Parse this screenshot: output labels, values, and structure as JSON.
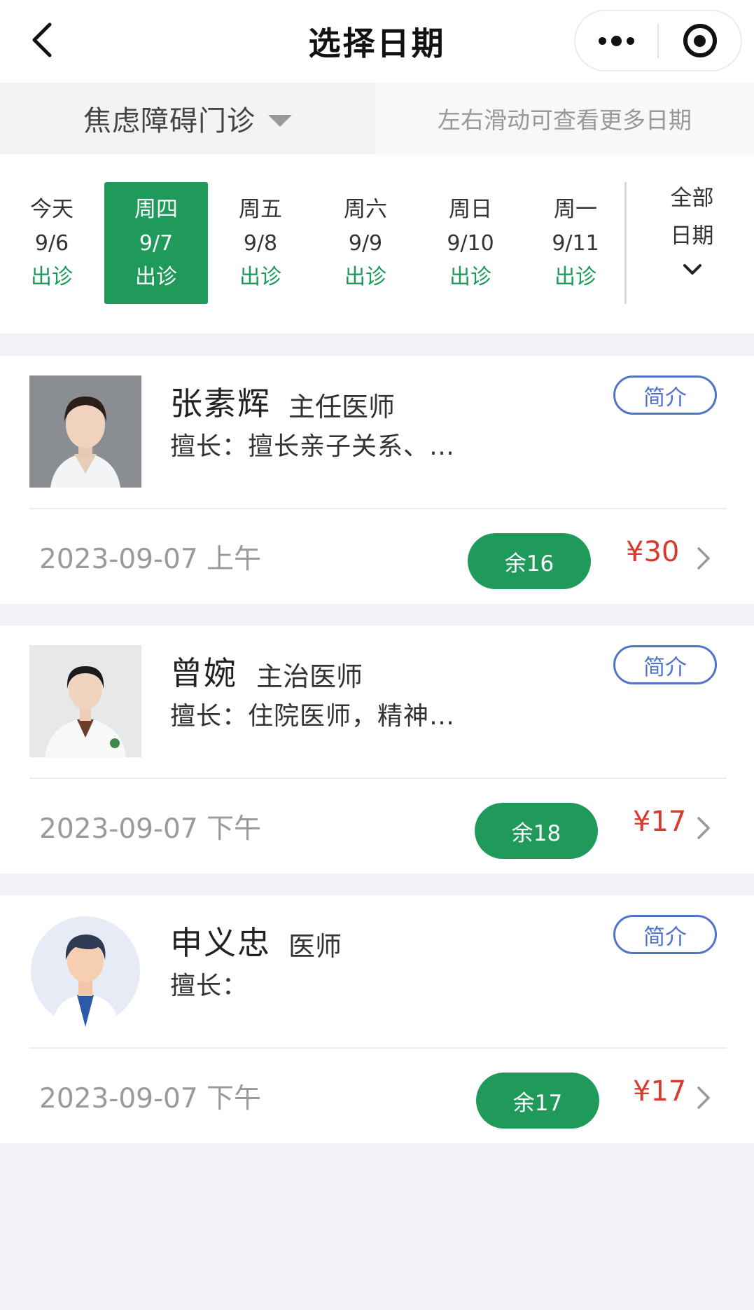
{
  "nav": {
    "title": "选择日期"
  },
  "dept_bar": {
    "department": "焦虑障碍门诊",
    "hint": "左右滑动可查看更多日期"
  },
  "dates": [
    {
      "weekday": "今天",
      "date": "9/6",
      "status": "出诊"
    },
    {
      "weekday": "周四",
      "date": "9/7",
      "status": "出诊",
      "selected": true
    },
    {
      "weekday": "周五",
      "date": "9/8",
      "status": "出诊"
    },
    {
      "weekday": "周六",
      "date": "9/9",
      "status": "出诊"
    },
    {
      "weekday": "周日",
      "date": "9/10",
      "status": "出诊"
    },
    {
      "weekday": "周一",
      "date": "9/11",
      "status": "出诊"
    }
  ],
  "all_dates": {
    "line1": "全部",
    "line2": "日期"
  },
  "doctors": [
    {
      "name": "张素辉",
      "title": "主任医师",
      "specialty": "擅长：擅长亲子关系、…",
      "intro_label": "简介",
      "slot_time": "2023-09-07 上午",
      "remaining": "余16",
      "price": "¥30"
    },
    {
      "name": "曾婉",
      "title": "主治医师",
      "specialty": "擅长：住院医师，精神…",
      "intro_label": "简介",
      "slot_time": "2023-09-07 下午",
      "remaining": "余18",
      "price": "¥17"
    },
    {
      "name": "申义忠",
      "title": "医师",
      "specialty": "擅长：",
      "intro_label": "简介",
      "slot_time": "2023-09-07 下午",
      "remaining": "余17",
      "price": "¥17"
    }
  ],
  "colors": {
    "brand_green": "#1f9a5b",
    "price_red": "#d93a2e",
    "intro_blue": "#4f74c8"
  }
}
